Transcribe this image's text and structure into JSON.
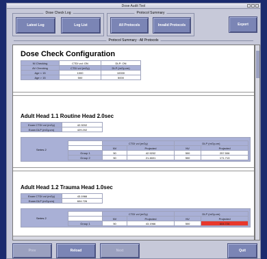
{
  "window": {
    "title": "Dose Audit Tool"
  },
  "dose_check_log": {
    "group_title": "Dose Check Log",
    "latest_log_label": "Latest Log",
    "log_list_label": "Log List"
  },
  "protocol_summary": {
    "group_title": "Protocol Summary",
    "all_protocols_label": "All Protocols",
    "invalid_protocols_label": "Invalid Protocols"
  },
  "export_label": "Export",
  "section_title": "Protocol Summary - All Protocols",
  "config": {
    "title": "Dose Check Configuration",
    "rows": [
      {
        "label": "NI Checking",
        "ctdi": "CTDI vol: ON",
        "dlp": "DLP: ON"
      },
      {
        "label": "AV Checking",
        "ctdi": "CTDI vol (mGy)",
        "dlp": "DLP (mGy.cm)"
      },
      {
        "label": "Age < 15",
        "ctdi": "1000",
        "dlp": "10000"
      },
      {
        "label": "Age > 15",
        "ctdi": "500",
        "dlp": "5000"
      }
    ]
  },
  "protocols": [
    {
      "title": "Adult Head 1.1 Routine Head 2.0sec",
      "exam_ctdi_label": "Exam CTDI vol (mGy)",
      "exam_ctdi": "42.9202",
      "exam_dlp_label": "Exam DLP (mGy.cm)",
      "exam_dlp": "429.202",
      "series_label": "Series 2",
      "ctdi_header": "CTDI vol (mGy)",
      "dlp_header": "DLP (mGy.cm)",
      "col_nv": "NV",
      "col_projected": "Projected",
      "groups": [
        {
          "name": "Group 1",
          "ctdi_nv": "50",
          "ctdi_proj": "42.9202",
          "dlp_nv": "500",
          "dlp_proj": "257.506"
        },
        {
          "name": "Group 2",
          "ctdi_nv": "50",
          "ctdi_proj": "21.4601",
          "dlp_nv": "500",
          "dlp_proj": "171.713"
        }
      ]
    },
    {
      "title": "Adult Head 1.2 Trauma Head 1.0sec",
      "exam_ctdi_label": "Exam CTDI vol (mGy)",
      "exam_ctdi": "43.1966",
      "exam_dlp_label": "Exam DLP (mGy.cm)",
      "exam_dlp": "604.726",
      "series_label": "Series 2",
      "ctdi_header": "CTDI vol (mGy)",
      "dlp_header": "DLP (mGy.cm)",
      "col_nv": "NV",
      "col_projected": "Projected",
      "groups": [
        {
          "name": "Group 1",
          "ctdi_nv": "50",
          "ctdi_proj": "43.1966",
          "dlp_nv": "500",
          "dlp_proj": "604.726",
          "dlp_exceeded": true
        }
      ]
    }
  ],
  "footer": {
    "prev_label": "Prev",
    "reload_label": "Reload",
    "next_label": "Next",
    "quit_label": "Quit"
  },
  "colors": {
    "button": "#7b85b5",
    "header_cell": "#a9b0d6",
    "alert": "#e8372c",
    "desktop": "#1b2b6e"
  }
}
